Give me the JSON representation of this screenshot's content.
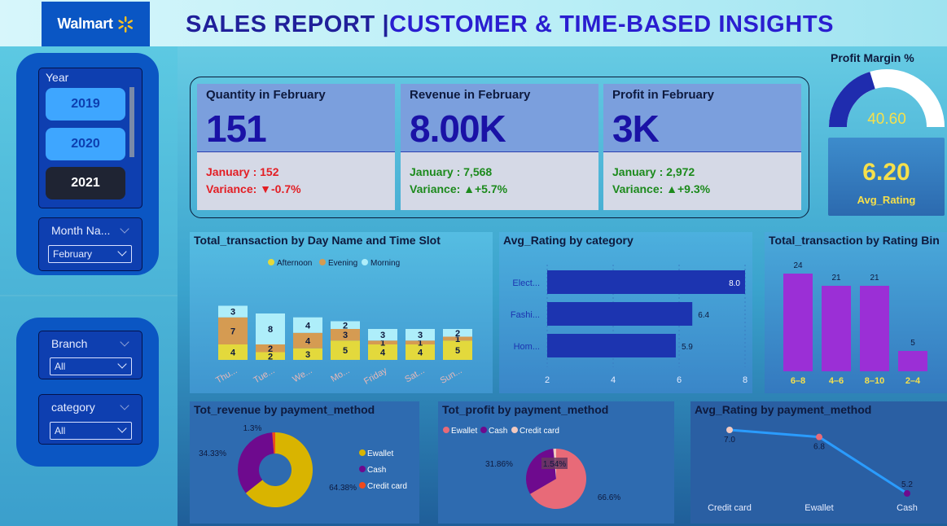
{
  "brand": {
    "logo_text": "Walmart"
  },
  "header": {
    "title_part1": "SALES REPORT |",
    "title_part2": "CUSTOMER & TIME-BASED INSIGHTS"
  },
  "slicers": {
    "year": {
      "label": "Year",
      "options": [
        "2019",
        "2020",
        "2021"
      ],
      "selected": "2021"
    },
    "month": {
      "label": "Month Na...",
      "value": "February"
    },
    "branch": {
      "label": "Branch",
      "value": "All"
    },
    "category": {
      "label": "category",
      "value": "All"
    }
  },
  "kpis": [
    {
      "title": "Quantity in February",
      "value": "151",
      "prev": "January : 152",
      "variance": "Variance: ▼-0.7%",
      "trend": "down"
    },
    {
      "title": "Revenue in February",
      "value": "8.00K",
      "prev": "January : 7,568",
      "variance": "Variance: ▲+5.7%",
      "trend": "up"
    },
    {
      "title": "Profit in February",
      "value": "3K",
      "prev": "January : 2,972",
      "variance": "Variance: ▲+9.3%",
      "trend": "up"
    }
  ],
  "profit_margin": {
    "title": "Profit Margin %",
    "value": "40.60",
    "fraction": 0.406
  },
  "avg_rating": {
    "value": "6.20",
    "label": "Avg_Rating"
  },
  "colors": {
    "afternoon": "#e3d93c",
    "evening": "#d59b52",
    "morning": "#aeeefa",
    "bars": "#1c34b0",
    "purple": "#9b2fd6",
    "ewallet": "#d9b400",
    "cash": "#6e0a8e",
    "credit": "#ef4a1c",
    "profit_ewallet": "#e86a78",
    "line": "#2a9cff"
  },
  "chart_data": [
    {
      "type": "bar",
      "stacked": true,
      "title": "Total_transaction by Day Name and Time Slot",
      "categories": [
        "Thu...",
        "Tue...",
        "We...",
        "Mo...",
        "Friday",
        "Sat...",
        "Sun..."
      ],
      "series": [
        {
          "name": "Afternoon",
          "values": [
            4,
            2,
            3,
            5,
            4,
            4,
            5
          ]
        },
        {
          "name": "Evening",
          "values": [
            7,
            2,
            4,
            3,
            1,
            1,
            1
          ]
        },
        {
          "name": "Morning",
          "values": [
            3,
            8,
            4,
            2,
            3,
            3,
            2
          ]
        }
      ],
      "legend": "top-center"
    },
    {
      "type": "bar",
      "orientation": "horizontal",
      "title": "Avg_Rating by category",
      "categories": [
        "Elect...",
        "Fashi...",
        "Hom..."
      ],
      "values": [
        8.0,
        6.4,
        5.9
      ],
      "xlim": [
        2,
        8
      ],
      "xticks": [
        "2",
        "4",
        "6",
        "8"
      ]
    },
    {
      "type": "bar",
      "title": "Total_transaction by Rating Bin",
      "categories": [
        "6–8",
        "4–6",
        "8–10",
        "2–4"
      ],
      "values": [
        24,
        21,
        21,
        5
      ]
    },
    {
      "type": "pie",
      "donut": true,
      "title": "Tot_revenue by payment_method",
      "labels": [
        "Ewallet",
        "Cash",
        "Credit card"
      ],
      "values": [
        64.38,
        34.33,
        1.3
      ],
      "value_labels": [
        "64.38%",
        "34.33%",
        "1.3%"
      ],
      "legend": "right"
    },
    {
      "type": "pie",
      "title": "Tot_profit by payment_method",
      "labels": [
        "Ewallet",
        "Cash",
        "Credit card"
      ],
      "values": [
        66.6,
        31.86,
        1.54
      ],
      "value_labels": [
        "66.6%",
        "31.86%",
        "1.54%"
      ],
      "legend": "top-left"
    },
    {
      "type": "line",
      "title": "Avg_Rating by payment_method",
      "categories": [
        "Credit card",
        "Ewallet",
        "Cash"
      ],
      "values": [
        7.0,
        6.8,
        5.2
      ],
      "value_labels": [
        "7.0",
        "6.8",
        "5.2"
      ]
    }
  ]
}
